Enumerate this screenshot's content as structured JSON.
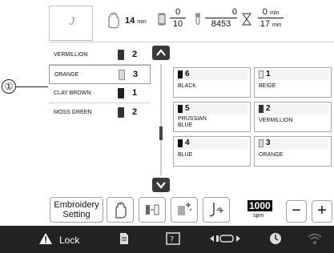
{
  "callout": {
    "label": "①"
  },
  "top_info": {
    "stitch_preview_glyph": "J",
    "time_value": "14",
    "time_unit": "min",
    "color_change_num": "0",
    "color_change_den": "10",
    "stitch_num": "0",
    "stitch_den": "8453",
    "remaining_num": "0",
    "remaining_num_unit": "min",
    "remaining_den": "17",
    "remaining_den_unit": "min"
  },
  "thread_list": [
    {
      "name": "VERMILLION",
      "count": "2",
      "color": "#333333",
      "selected": false
    },
    {
      "name": "ORANGE",
      "count": "3",
      "color": "#d8d8d8",
      "selected": true
    },
    {
      "name": "CLAY BROWN",
      "count": "1",
      "color": "#222222",
      "selected": false
    },
    {
      "name": "MOSS GREEN",
      "count": "2",
      "color": "#333333",
      "selected": false
    }
  ],
  "swatches": [
    {
      "number": "6",
      "name": "BLACK",
      "color": "#111111"
    },
    {
      "number": "1",
      "name": "BEIGE",
      "color": "#e6e6e6"
    },
    {
      "number": "5",
      "name": "PRUSSIAN\nBLUE",
      "color": "#111111"
    },
    {
      "number": "2",
      "name": "VERMILLION",
      "color": "#333333"
    },
    {
      "number": "4",
      "name": "BLUE",
      "color": "#111111"
    },
    {
      "number": "3",
      "name": "ORANGE",
      "color": "#d8d8d8"
    }
  ],
  "toolbar": {
    "embroidery_label_1": "Embroidery",
    "embroidery_label_2": "Setting",
    "speed_value": "1000",
    "speed_unit": "spm",
    "minus_label": "−",
    "plus_label": "+"
  },
  "statusbar": {
    "lock_label": "Lock"
  },
  "colors": {
    "dark_button": "#3a3a3a",
    "statusbar": "#222222",
    "border": "#a8a8a8"
  }
}
